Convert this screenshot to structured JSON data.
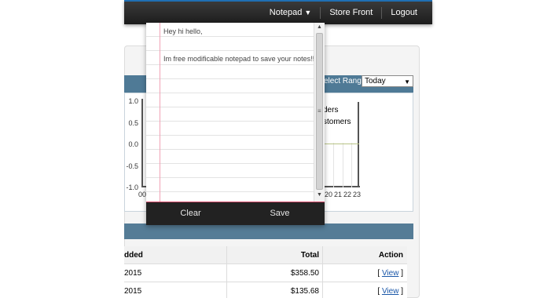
{
  "nav": {
    "notepad": "Notepad",
    "notepad_caret": "▼",
    "store_front": "Store Front",
    "logout": "Logout"
  },
  "notepad": {
    "lines": [
      "Hey hi hello,",
      "Im free modificable notepad to save your notes!!"
    ],
    "clear_label": "Clear",
    "save_label": "Save"
  },
  "chart": {
    "range_label": "elect Range:",
    "range_value": "Today",
    "y_ticks": [
      "1.0",
      "0.5",
      "0.0",
      "-0.5",
      "-1.0"
    ],
    "legend_fragments": [
      "ders",
      "stomers"
    ],
    "x_tick_left": "00",
    "x_ticks_right": [
      "20",
      "21",
      "22",
      "23"
    ]
  },
  "orders": {
    "columns": [
      "dded",
      "Total",
      "Action"
    ],
    "rows": [
      {
        "date": "2015",
        "total": "$358.50",
        "action": "View"
      },
      {
        "date": "2015",
        "total": "$135.68",
        "action": "View"
      }
    ]
  },
  "colors": {
    "nav_bg": "#2a2a2a",
    "accent_blue": "#4f7a96",
    "link": "#1a57a8",
    "notepad_margin": "#f1a2b5"
  }
}
